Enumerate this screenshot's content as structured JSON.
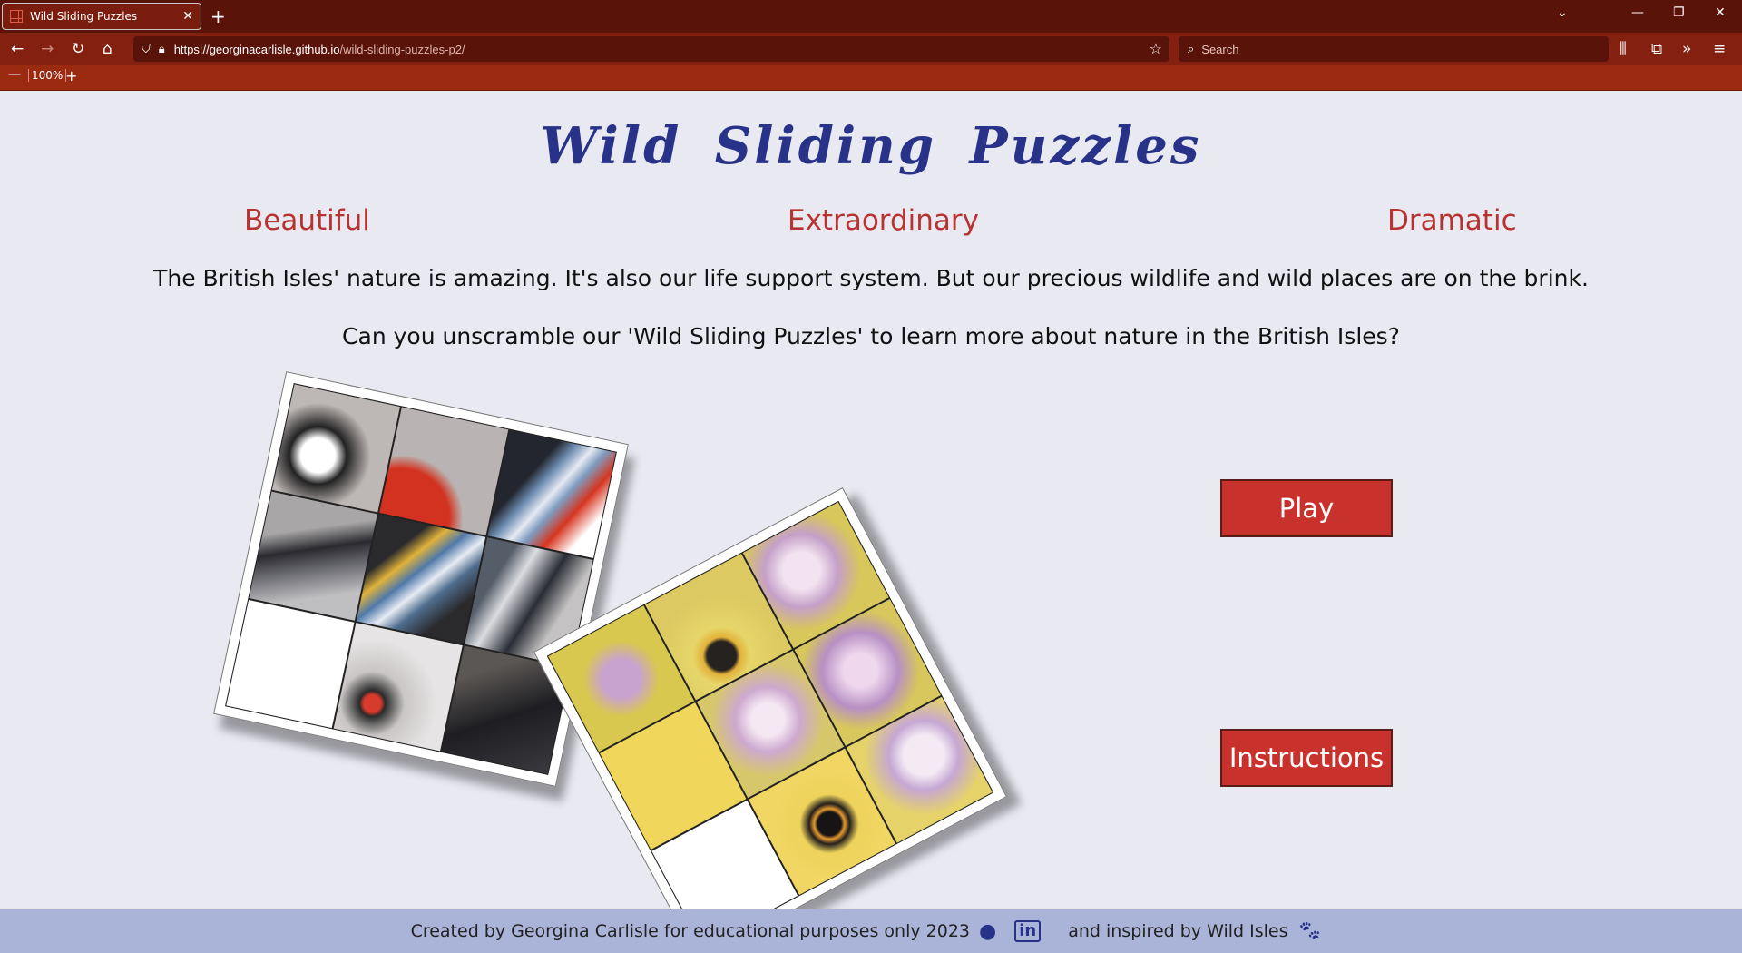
{
  "browser": {
    "tab_title": "Wild Sliding Puzzles",
    "url_host": "https://georginacarlisle.github.io",
    "url_path": "/wild-sliding-puzzles-p2/",
    "search_placeholder": "Search",
    "zoom_level": "100%"
  },
  "page": {
    "title": "Wild Sliding Puzzles",
    "taglines": [
      "Beautiful",
      "Extraordinary",
      "Dramatic"
    ],
    "intro_1": "The British Isles' nature is amazing. It's also our life support system. But our precious wildlife and wild places are on the brink.",
    "intro_2": "Can you unscramble our 'Wild Sliding Puzzles' to learn more about nature in the British Isles?",
    "buttons": {
      "play": "Play",
      "instructions": "Instructions"
    }
  },
  "footer": {
    "credit": "Created by Georgina Carlisle for educational purposes only 2023",
    "inspired": "and inspired by Wild Isles"
  },
  "colors": {
    "accent_red": "#c8312c",
    "title_blue": "#283289",
    "tagline_red": "#b83230",
    "footer_bg": "#aab4d9",
    "page_bg": "#e8e9f1"
  }
}
